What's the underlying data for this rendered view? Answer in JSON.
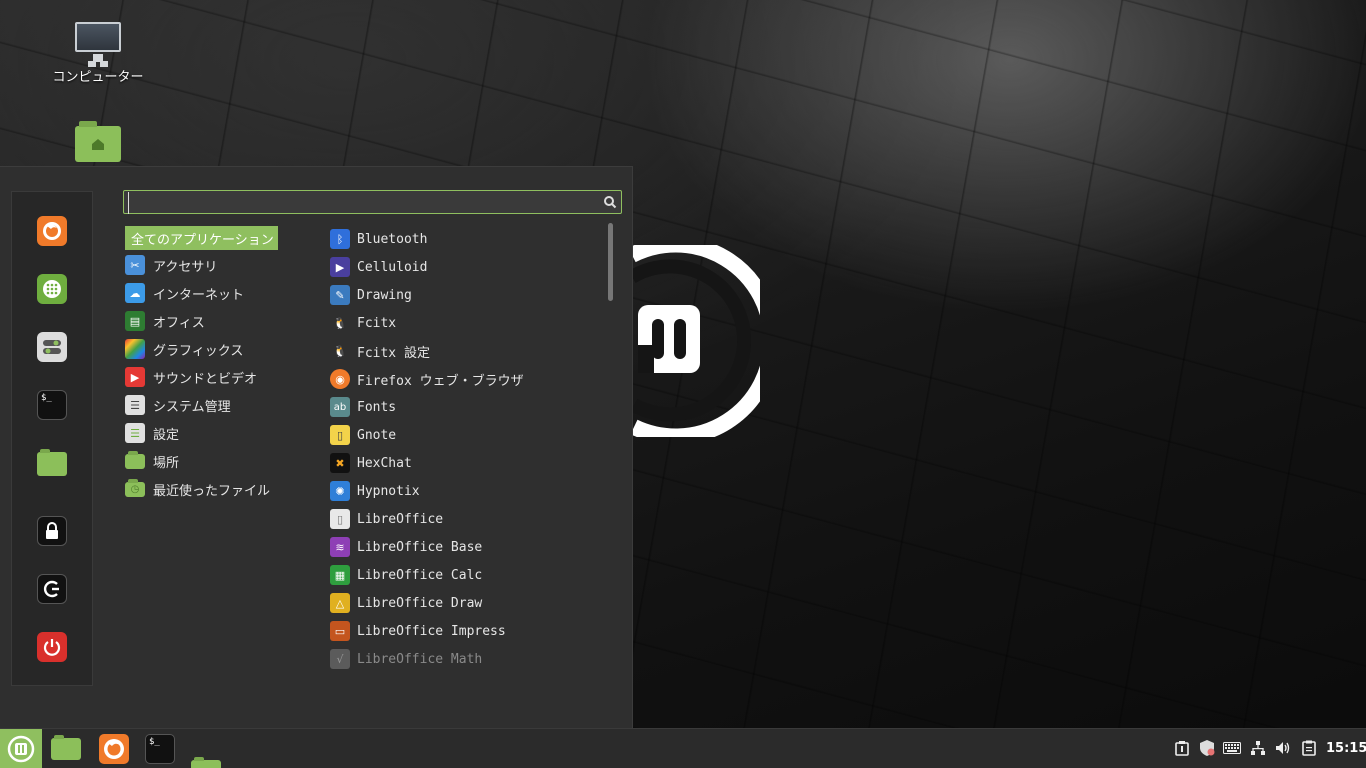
{
  "desktop": {
    "icons": [
      {
        "label": "コンピューター",
        "icon": "monitor-icon"
      },
      {
        "label": "",
        "icon": "home-folder-icon"
      }
    ]
  },
  "menu": {
    "search": {
      "value": "",
      "placeholder": ""
    },
    "favorites": [
      {
        "name": "firefox",
        "icon": "firefox-icon",
        "color": "#f07a2a"
      },
      {
        "name": "software-manager",
        "icon": "software-manager-icon",
        "color": "#6fae3f"
      },
      {
        "name": "settings",
        "icon": "toggle-settings-icon",
        "color": "#d9d9d9"
      },
      {
        "name": "terminal",
        "icon": "terminal-icon",
        "color": "#111111"
      },
      {
        "name": "files",
        "icon": "folder-icon",
        "color": "#8cbf5a"
      },
      {
        "name": "lock-screen",
        "icon": "lock-icon",
        "color": "#111111"
      },
      {
        "name": "logout",
        "icon": "logout-icon",
        "color": "#111111"
      },
      {
        "name": "shutdown",
        "icon": "power-icon",
        "color": "#d9302c"
      }
    ],
    "categories": [
      {
        "label": "全てのアプリケーション",
        "selected": true
      },
      {
        "label": "アクセサリ",
        "icon": "scissors-icon"
      },
      {
        "label": "インターネット",
        "icon": "cloud-icon"
      },
      {
        "label": "オフィス",
        "icon": "office-icon"
      },
      {
        "label": "グラフィックス",
        "icon": "graphics-icon"
      },
      {
        "label": "サウンドとビデオ",
        "icon": "play-icon"
      },
      {
        "label": "システム管理",
        "icon": "system-icon"
      },
      {
        "label": "設定",
        "icon": "settings-icon"
      },
      {
        "label": "場所",
        "icon": "folder-icon"
      },
      {
        "label": "最近使ったファイル",
        "icon": "recent-folder-icon"
      }
    ],
    "apps": [
      {
        "label": "Bluetooth",
        "icon": "bluetooth-icon"
      },
      {
        "label": "Celluloid",
        "icon": "celluloid-icon"
      },
      {
        "label": "Drawing",
        "icon": "drawing-icon"
      },
      {
        "label": "Fcitx",
        "icon": "penguin-icon"
      },
      {
        "label": "Fcitx 設定",
        "icon": "penguin-icon"
      },
      {
        "label": "Firefox ウェブ・ブラウザ",
        "icon": "firefox-icon"
      },
      {
        "label": "Fonts",
        "icon": "fonts-icon"
      },
      {
        "label": "Gnote",
        "icon": "gnote-icon"
      },
      {
        "label": "HexChat",
        "icon": "hexchat-icon"
      },
      {
        "label": "Hypnotix",
        "icon": "hypnotix-icon"
      },
      {
        "label": "LibreOffice",
        "icon": "libreoffice-icon"
      },
      {
        "label": "LibreOffice Base",
        "icon": "libreoffice-base-icon"
      },
      {
        "label": "LibreOffice Calc",
        "icon": "libreoffice-calc-icon"
      },
      {
        "label": "LibreOffice Draw",
        "icon": "libreoffice-draw-icon"
      },
      {
        "label": "LibreOffice Impress",
        "icon": "libreoffice-impress-icon"
      },
      {
        "label": "LibreOffice Math",
        "icon": "libreoffice-math-icon"
      }
    ]
  },
  "taskbar": {
    "clock": "15:15",
    "launchers": [
      "folder-icon",
      "firefox-icon",
      "terminal-icon",
      "folder-icon"
    ],
    "tray": [
      "notification-icon",
      "shield-update-icon",
      "keyboard-icon",
      "network-icon",
      "volume-icon",
      "clipboard-icon"
    ]
  },
  "colors": {
    "accent": "#8fbf5f",
    "menu_bg": "#2f2f2f",
    "taskbar_bg": "#2b2b2b"
  }
}
